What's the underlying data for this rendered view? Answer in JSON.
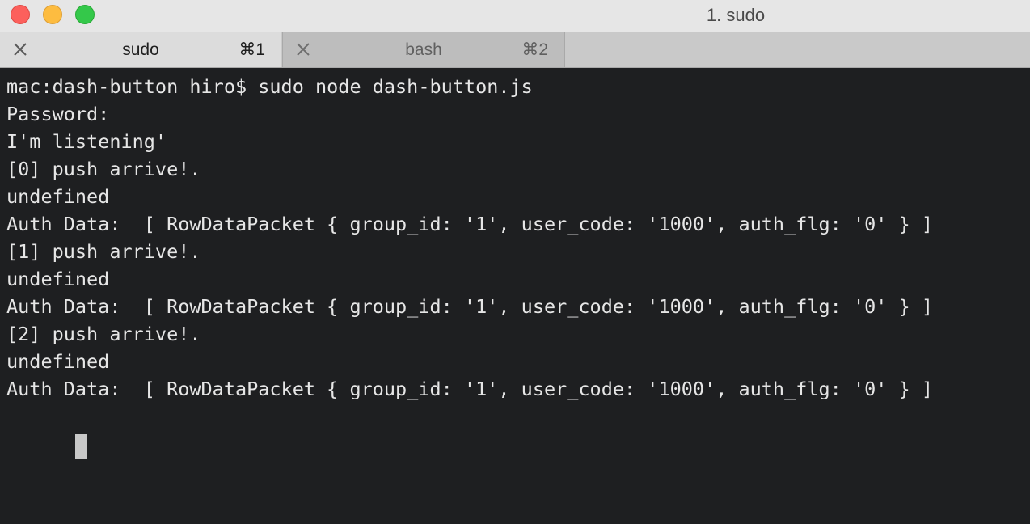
{
  "window": {
    "title": "1. sudo"
  },
  "tabs": [
    {
      "label": "sudo",
      "shortcut": "⌘1",
      "active": true
    },
    {
      "label": "bash",
      "shortcut": "⌘2",
      "active": false
    }
  ],
  "terminal": {
    "lines": [
      "mac:dash-button hiro$ sudo node dash-button.js",
      "Password:",
      "I'm listening'",
      "[0] push arrive!.",
      "undefined",
      "Auth Data:  [ RowDataPacket { group_id: '1', user_code: '1000', auth_flg: '0' } ]",
      "[1] push arrive!.",
      "undefined",
      "Auth Data:  [ RowDataPacket { group_id: '1', user_code: '1000', auth_flg: '0' } ]",
      "[2] push arrive!.",
      "undefined",
      "Auth Data:  [ RowDataPacket { group_id: '1', user_code: '1000', auth_flg: '0' } ]"
    ]
  },
  "colors": {
    "background": "#1e1f21",
    "text": "#e6e6e6",
    "cursor": "#c8c8c8"
  },
  "icons": {
    "tab_close": "close-icon"
  }
}
